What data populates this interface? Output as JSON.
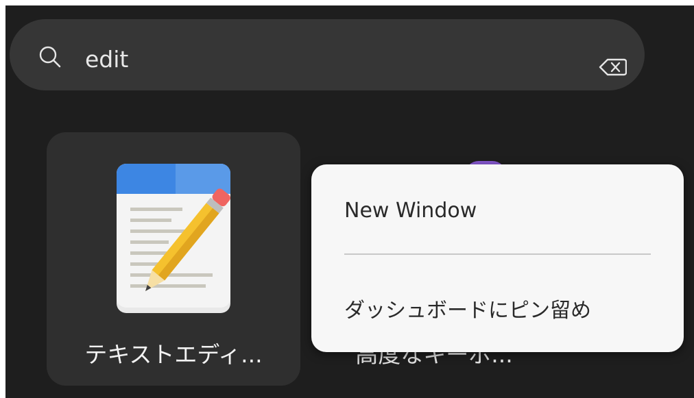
{
  "search": {
    "query": "edit",
    "icon": "search-icon",
    "clear_icon": "backspace-clear-icon"
  },
  "results": [
    {
      "label": "テキストエディ...",
      "icon": "text-editor-icon"
    },
    {
      "label": "高度なキーボ..."
    }
  ],
  "context_menu": {
    "items": [
      {
        "label": "New Window"
      },
      {
        "label": "ダッシュボードにピン留め"
      }
    ]
  },
  "colors": {
    "background": "#1e1e1e",
    "search_bar": "#363636",
    "tile": "#2f2f2f",
    "menu": "#f7f7f7"
  }
}
